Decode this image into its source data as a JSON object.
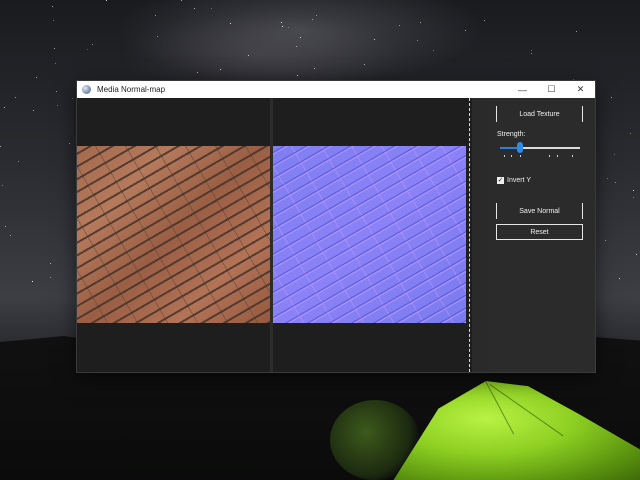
{
  "window": {
    "title": "Media Normal-map",
    "minimize_glyph": "—",
    "maximize_glyph": "☐",
    "close_glyph": "✕"
  },
  "panels": {
    "source_label": "source texture preview",
    "normal_label": "normal map preview"
  },
  "sidebar": {
    "load_button": "Load Texture",
    "strength_label": "Strength:",
    "strength_fraction": 0.25,
    "invert_label": "Invert Y",
    "invert_checked": true,
    "check_glyph": "✓",
    "save_button": "Save Normal",
    "reset_button": "Reset"
  },
  "colors": {
    "accent": "#2f8be8",
    "window_bg": "#1e1e1e",
    "sidebar_bg": "#2b2b2b",
    "tent_green": "#8ed022"
  },
  "icons": {
    "app": "app-globe-icon",
    "check": "checkmark-icon"
  }
}
